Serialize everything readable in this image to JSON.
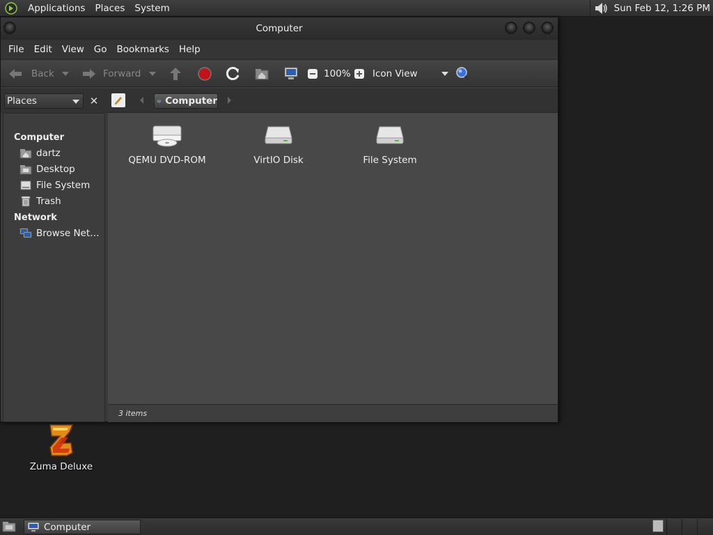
{
  "top_panel": {
    "menus": [
      "Applications",
      "Places",
      "System"
    ],
    "clock": "Sun Feb 12,  1:26 PM"
  },
  "window": {
    "title": "Computer",
    "menus": [
      "File",
      "Edit",
      "View",
      "Go",
      "Bookmarks",
      "Help"
    ],
    "toolbar": {
      "back_label": "Back",
      "forward_label": "Forward",
      "zoom_level": "100%",
      "view_mode": "Icon View"
    },
    "sidebar": {
      "combo_label": "Places",
      "sections": [
        {
          "heading": "Computer",
          "items": [
            "dartz",
            "Desktop",
            "File System",
            "Trash"
          ]
        },
        {
          "heading": "Network",
          "items": [
            "Browse Net…"
          ]
        }
      ]
    },
    "location": {
      "current": "Computer"
    },
    "files": [
      "QEMU DVD-ROM",
      "VirtIO Disk",
      "File System"
    ],
    "status": "3 items"
  },
  "desktop": {
    "icons": [
      "Zuma Deluxe"
    ]
  },
  "bottom_panel": {
    "task_label": "Computer"
  },
  "colors": {
    "panel": "#2e2e2e",
    "window_bg": "#3a3a3a",
    "content_bg": "#484848",
    "stop": "#c0141a",
    "search": "#3a6fd8"
  }
}
